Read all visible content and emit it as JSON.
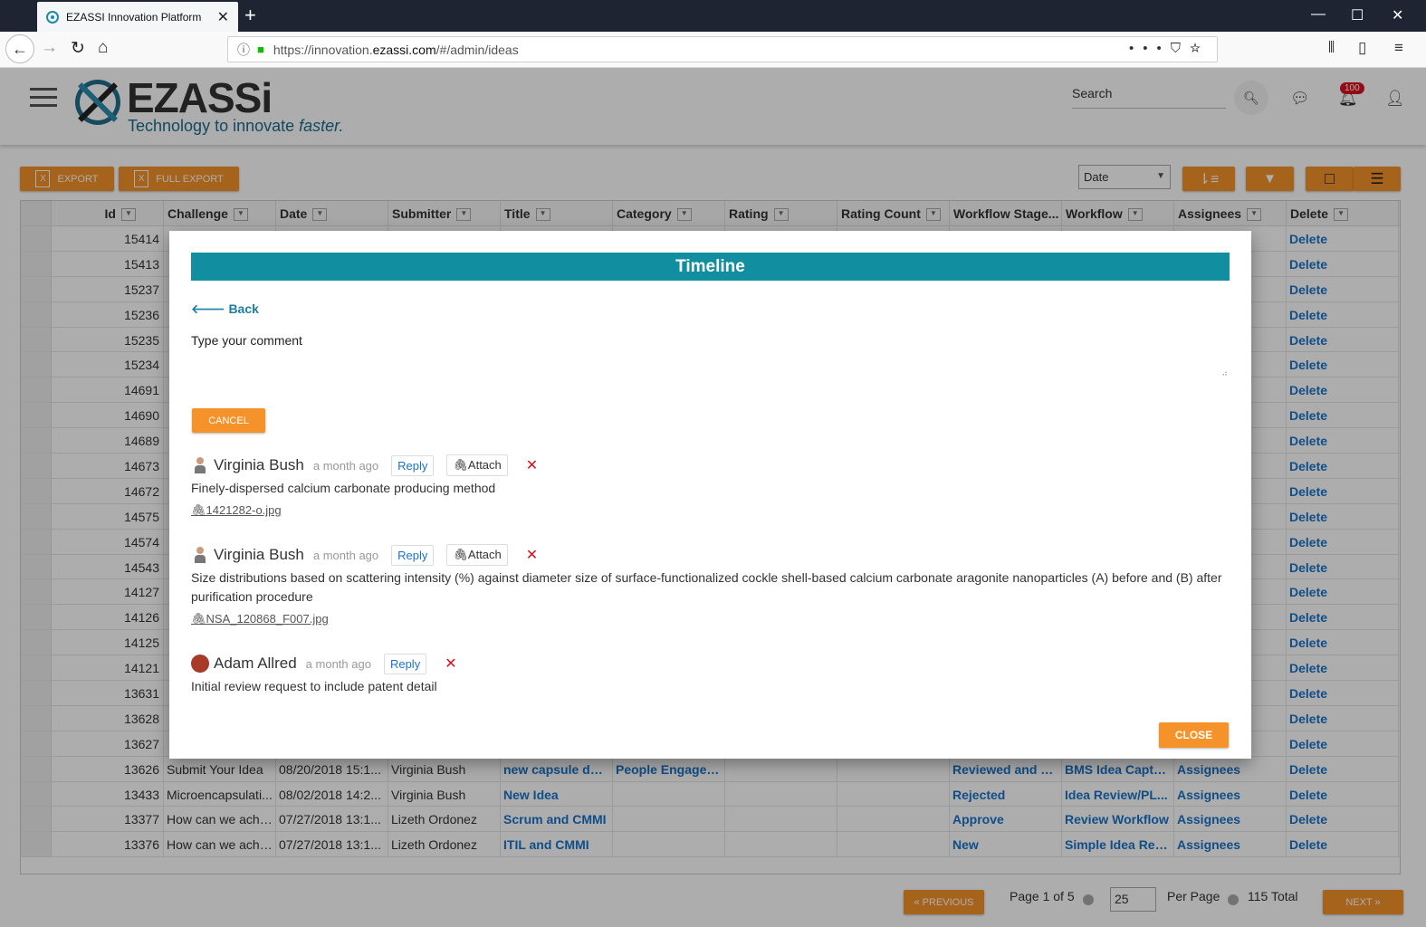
{
  "browser": {
    "tab_title": "EZASSI Innovation Platform",
    "url_prefix": "https://innovation.",
    "url_domain": "ezassi.com",
    "url_path": "/#/admin/ideas"
  },
  "header": {
    "logo_text": "EZASSi",
    "logo_tagline": "Technology to innovate",
    "logo_tagline_em": "faster.",
    "search_label": "Search",
    "notification_count": "100"
  },
  "toolbar": {
    "export_label": "EXPORT",
    "full_export_label": "FULL EXPORT",
    "date_select": "Date"
  },
  "grid": {
    "columns": [
      "Id",
      "Challenge",
      "Date",
      "Submitter",
      "Title",
      "Category",
      "Rating",
      "Rating Count",
      "Workflow Stage...",
      "Workflow",
      "Assignees",
      "Delete"
    ],
    "rows": [
      {
        "id": "15414",
        "challenge": "",
        "date": "",
        "submitter": "",
        "title": "",
        "category": "",
        "stage": "",
        "workflow": "",
        "assignees": "",
        "delete": "Delete"
      },
      {
        "id": "15413",
        "challenge": "",
        "date": "",
        "submitter": "",
        "title": "",
        "category": "",
        "stage": "",
        "workflow": "",
        "assignees": "",
        "delete": "Delete"
      },
      {
        "id": "15237",
        "challenge": "",
        "date": "",
        "submitter": "",
        "title": "",
        "category": "",
        "stage": "",
        "workflow": "",
        "assignees": "",
        "delete": "Delete"
      },
      {
        "id": "15236",
        "challenge": "",
        "date": "",
        "submitter": "",
        "title": "",
        "category": "",
        "stage": "",
        "workflow": "",
        "assignees": "",
        "delete": "Delete"
      },
      {
        "id": "15235",
        "challenge": "",
        "date": "",
        "submitter": "",
        "title": "",
        "category": "",
        "stage": "",
        "workflow": "",
        "assignees": "",
        "delete": "Delete"
      },
      {
        "id": "15234",
        "challenge": "",
        "date": "",
        "submitter": "",
        "title": "",
        "category": "",
        "stage": "",
        "workflow": "",
        "assignees": "",
        "delete": "Delete"
      },
      {
        "id": "14691",
        "challenge": "",
        "date": "",
        "submitter": "",
        "title": "",
        "category": "",
        "stage": "",
        "workflow": "",
        "assignees": "",
        "delete": "Delete"
      },
      {
        "id": "14690",
        "challenge": "",
        "date": "",
        "submitter": "",
        "title": "",
        "category": "",
        "stage": "",
        "workflow": "",
        "assignees": "",
        "delete": "Delete"
      },
      {
        "id": "14689",
        "challenge": "",
        "date": "",
        "submitter": "",
        "title": "",
        "category": "",
        "stage": "",
        "workflow": "",
        "assignees": "",
        "delete": "Delete"
      },
      {
        "id": "14673",
        "challenge": "",
        "date": "",
        "submitter": "",
        "title": "",
        "category": "",
        "stage": "",
        "workflow": "",
        "assignees": "",
        "delete": "Delete"
      },
      {
        "id": "14672",
        "challenge": "",
        "date": "",
        "submitter": "",
        "title": "",
        "category": "",
        "stage": "",
        "workflow": "",
        "assignees": "",
        "delete": "Delete"
      },
      {
        "id": "14575",
        "challenge": "",
        "date": "",
        "submitter": "",
        "title": "",
        "category": "",
        "stage": "",
        "workflow": "",
        "assignees": "",
        "delete": "Delete"
      },
      {
        "id": "14574",
        "challenge": "",
        "date": "",
        "submitter": "",
        "title": "",
        "category": "",
        "stage": "",
        "workflow": "",
        "assignees": "",
        "delete": "Delete"
      },
      {
        "id": "14543",
        "challenge": "",
        "date": "",
        "submitter": "",
        "title": "",
        "category": "",
        "stage": "",
        "workflow": "",
        "assignees": "",
        "delete": "Delete"
      },
      {
        "id": "14127",
        "challenge": "",
        "date": "",
        "submitter": "",
        "title": "",
        "category": "",
        "stage": "",
        "workflow": "",
        "assignees": "",
        "delete": "Delete"
      },
      {
        "id": "14126",
        "challenge": "",
        "date": "",
        "submitter": "",
        "title": "",
        "category": "",
        "stage": "",
        "workflow": "",
        "assignees": "",
        "delete": "Delete"
      },
      {
        "id": "14125",
        "challenge": "",
        "date": "",
        "submitter": "",
        "title": "",
        "category": "",
        "stage": "",
        "workflow": "",
        "assignees": "",
        "delete": "Delete"
      },
      {
        "id": "14121",
        "challenge": "",
        "date": "",
        "submitter": "",
        "title": "",
        "category": "",
        "stage": "",
        "workflow": "",
        "assignees": "",
        "delete": "Delete"
      },
      {
        "id": "13631",
        "challenge": "",
        "date": "",
        "submitter": "",
        "title": "",
        "category": "",
        "stage": "",
        "workflow": "",
        "assignees": "",
        "delete": "Delete"
      },
      {
        "id": "13628",
        "challenge": "",
        "date": "",
        "submitter": "",
        "title": "",
        "category": "",
        "stage": "",
        "workflow": "",
        "assignees": "",
        "delete": "Delete"
      },
      {
        "id": "13627",
        "challenge": "",
        "date": "",
        "submitter": "",
        "title": "",
        "category": "",
        "stage": "",
        "workflow": "",
        "assignees": "",
        "delete": "Delete"
      },
      {
        "id": "13626",
        "challenge": "Submit Your Idea",
        "date": "08/20/2018 15:1...",
        "submitter": "Virginia Bush",
        "title": "new capsule des...",
        "category": "People Engagem...",
        "stage": "Reviewed and Fil...",
        "workflow": "BMS Idea Capture",
        "assignees": "Assignees",
        "delete": "Delete"
      },
      {
        "id": "13433",
        "challenge": "Microencapsulati...",
        "date": "08/02/2018 14:2...",
        "submitter": "Virginia Bush",
        "title": "New Idea",
        "category": "",
        "stage": "Rejected",
        "workflow": "Idea Review/PL...",
        "assignees": "Assignees",
        "delete": "Delete"
      },
      {
        "id": "13377",
        "challenge": "How can we achi...",
        "date": "07/27/2018 13:1...",
        "submitter": "Lizeth Ordonez",
        "title": "Scrum and CMMI",
        "category": "",
        "stage": "Approve",
        "workflow": "Review Workflow",
        "assignees": "Assignees",
        "delete": "Delete"
      },
      {
        "id": "13376",
        "challenge": "How can we achi...",
        "date": "07/27/2018 13:1...",
        "submitter": "Lizeth Ordonez",
        "title": "ITIL and CMMI",
        "category": "",
        "stage": "New",
        "workflow": "Simple Idea Revi...",
        "assignees": "Assignees",
        "delete": "Delete"
      }
    ]
  },
  "pager": {
    "previous": "« PREVIOUS",
    "page_text": "Page 1 of 5",
    "per_page_value": "25",
    "per_page_label": "Per Page",
    "total": "115 Total",
    "next": "NEXT »"
  },
  "modal": {
    "title": "Timeline",
    "back": "Back",
    "comment_placeholder": "Type your comment",
    "cancel": "CANCEL",
    "close": "CLOSE",
    "comments": [
      {
        "author": "Virginia Bush",
        "time": "a month ago",
        "reply": "Reply",
        "attach": "Attach",
        "text": "Finely-dispersed calcium carbonate producing method",
        "file": "1421282-o.jpg"
      },
      {
        "author": "Virginia Bush",
        "time": "a month ago",
        "reply": "Reply",
        "attach": "Attach",
        "text": "Size distributions based on scattering intensity (%) against diameter size of surface-functionalized cockle shell-based calcium carbonate aragonite nanoparticles (A) before and (B) after purification procedure",
        "file": "NSA_120868_F007.jpg"
      },
      {
        "author": "Adam Allred",
        "time": "a month ago",
        "reply": "Reply",
        "attach": "",
        "text": "Initial review request to include patent detail",
        "file": ""
      }
    ]
  },
  "colors": {
    "accent_orange": "#f5922a",
    "timeline_teal": "#118fa1",
    "link_blue": "#1a73c8"
  }
}
